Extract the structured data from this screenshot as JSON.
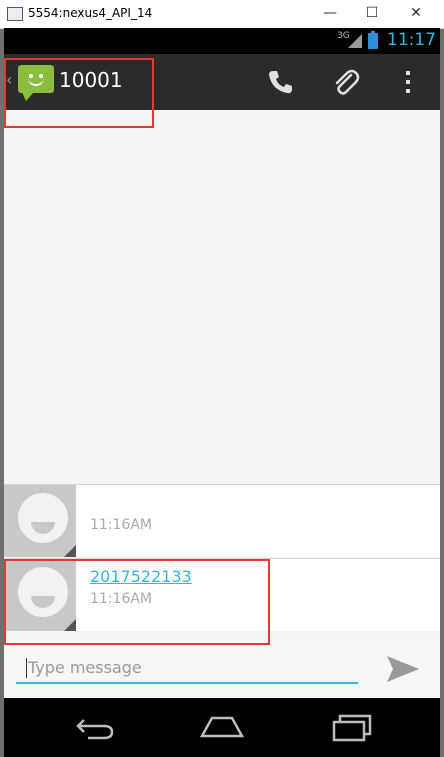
{
  "window": {
    "title": "5554:nexus4_API_14",
    "minimize": "—",
    "maximize": "☐",
    "close": "✕"
  },
  "status_bar": {
    "network": "3G",
    "time": "11:17"
  },
  "action_bar": {
    "title": "10001",
    "actions": [
      "phone-icon",
      "attach-icon",
      "overflow-menu-icon"
    ]
  },
  "messages": [
    {
      "text": "",
      "time": "11:16AM"
    },
    {
      "text": "2017522133",
      "time": "11:16AM"
    }
  ],
  "composer": {
    "placeholder": "Type message"
  },
  "nav": [
    "back-icon",
    "home-icon",
    "recent-apps-icon"
  ],
  "colors": {
    "accent": "#33b5e5",
    "highlight": "#e53935",
    "action_bar": "#2b2b2b",
    "app_icon": "#8dbd3c"
  }
}
